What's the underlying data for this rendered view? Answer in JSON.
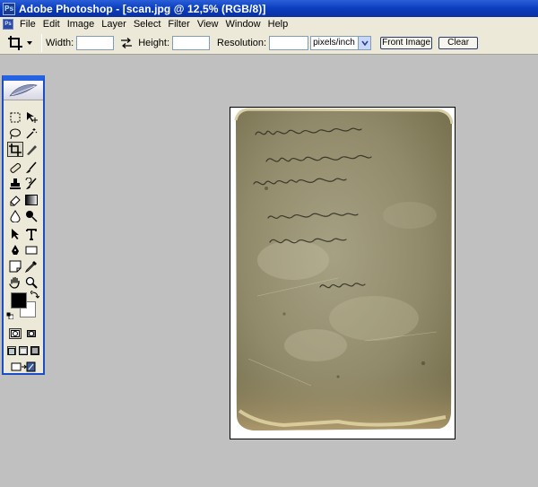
{
  "window": {
    "title": "Adobe Photoshop - [scan.jpg @ 12,5% (RGB/8)]",
    "icon": "photoshop-app-icon"
  },
  "menu": [
    "File",
    "Edit",
    "Image",
    "Layer",
    "Select",
    "Filter",
    "View",
    "Window",
    "Help"
  ],
  "options_bar": {
    "tool": "crop-tool",
    "width_label": "Width:",
    "width_value": "",
    "height_label": "Height:",
    "height_value": "",
    "resolution_label": "Resolution:",
    "resolution_value": "",
    "resolution_unit": "pixels/inch",
    "front_image_label": "Front Image",
    "clear_label": "Clear"
  },
  "toolbox": {
    "logo": "feather-logo",
    "foreground_color": "#000000",
    "background_color": "#ffffff"
  },
  "document": {
    "name": "scan.jpg",
    "zoom": "12,5%",
    "mode": "RGB/8"
  },
  "colors": {
    "title_blue": "#0a3dbd",
    "workspace_gray": "#c0c0c0",
    "chrome": "#ece9d8"
  }
}
